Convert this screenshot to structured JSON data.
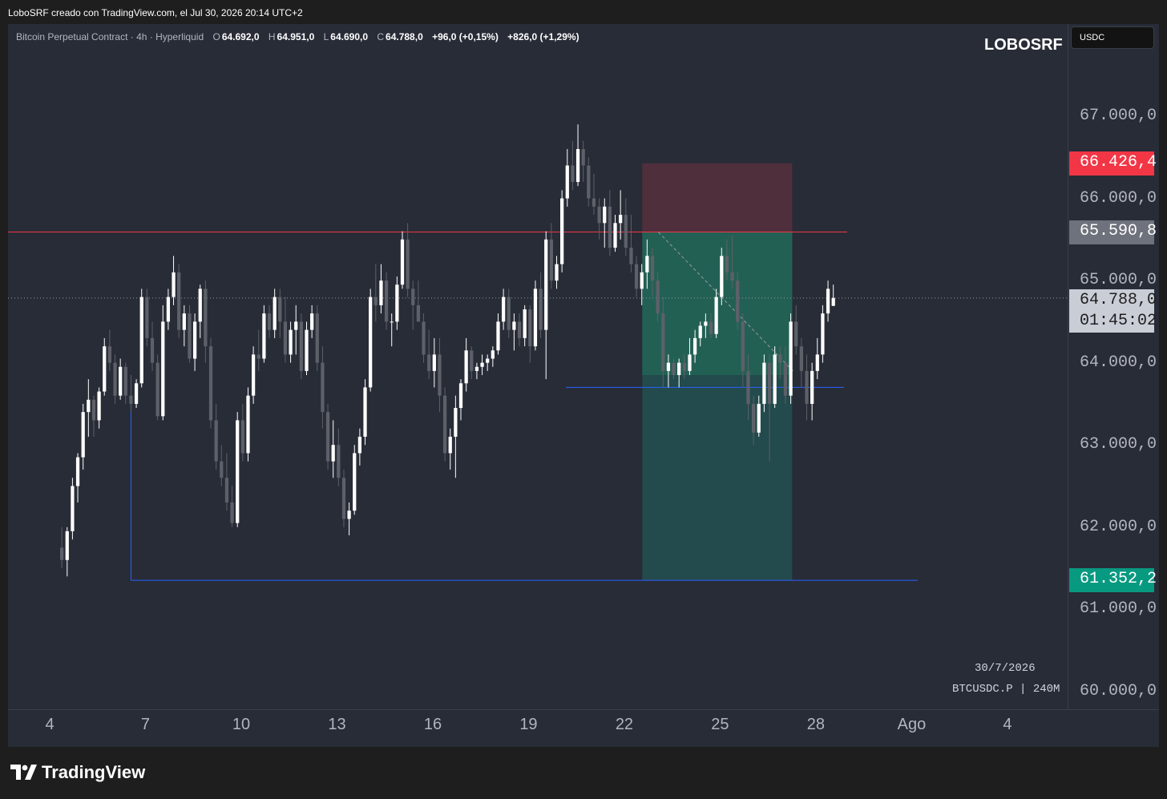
{
  "header": {
    "caption": "LoboSRF creado con TradingView.com, el Jul 30, 2026 20:14 UTC+2"
  },
  "legend": {
    "symbol_title": "Bitcoin Perpetual Contract · 4h · Hyperliquid",
    "o_label": "O",
    "o_value": "64.692,0",
    "h_label": "H",
    "h_value": "64.951,0",
    "l_label": "L",
    "l_value": "64.690,0",
    "c_label": "C",
    "c_value": "64.788,0",
    "change": "+96,0 (+0,15%)",
    "change2": "+826,0 (+1,29%)"
  },
  "author": "LOBOSRF",
  "currency": "USDC",
  "price_labels": {
    "stop": "66.426,4",
    "entry": "65.590,8",
    "target": "61.352,2",
    "current": "64.788,0",
    "countdown": "01:45:02"
  },
  "watermark": {
    "date": "30/7/2026",
    "symbol": "BTCUSDC.P | 240M"
  },
  "footer": {
    "brand": "TradingView"
  },
  "colors": {
    "up": "#ffffff",
    "down": "#5d6068",
    "stop_zone": "#4f2f3c",
    "target_zone": "#234a4c",
    "profit_fill": "#236054",
    "stop_badge": "#f23645",
    "entry_badge": "#6e727c",
    "target_badge": "#089981",
    "resistance": "#f23645",
    "support": "#2962ff"
  },
  "chart_data": {
    "type": "candlestick",
    "timeframe": "4h",
    "y_ticks": [
      67000,
      66000,
      65000,
      64000,
      63000,
      62000,
      61000,
      60000
    ],
    "y_tick_labels": [
      "67.000,0",
      "66.000,0",
      "65.000,0",
      "64.000,0",
      "63.000,0",
      "62.000,0",
      "61.000,0",
      "60.000,0"
    ],
    "ylim": [
      59760,
      68500
    ],
    "x_ticks": [
      "4",
      "7",
      "10",
      "13",
      "16",
      "19",
      "22",
      "25",
      "28",
      "Ago",
      "4"
    ],
    "x_tick_days": [
      4,
      7,
      10,
      13,
      16,
      19,
      22,
      25,
      28,
      31,
      34
    ],
    "first_candle_day": 4.38,
    "candles_per_day": 6,
    "candles": [
      [
        61750,
        62000,
        61500,
        61600
      ],
      [
        61600,
        62000,
        61400,
        61950
      ],
      [
        61950,
        62600,
        61850,
        62500
      ],
      [
        62500,
        62900,
        62300,
        62850
      ],
      [
        62850,
        63500,
        62700,
        63400
      ],
      [
        63400,
        63800,
        63100,
        63550
      ],
      [
        63550,
        63600,
        63100,
        63300
      ],
      [
        63300,
        63700,
        63200,
        63650
      ],
      [
        63650,
        64300,
        63600,
        64200
      ],
      [
        64200,
        64400,
        63900,
        64000
      ],
      [
        64000,
        64100,
        63500,
        63600
      ],
      [
        63600,
        64050,
        63550,
        63950
      ],
      [
        63950,
        64000,
        63500,
        63600
      ],
      [
        63600,
        63850,
        63400,
        63500
      ],
      [
        63500,
        63800,
        63450,
        63750
      ],
      [
        63750,
        64900,
        63700,
        64800
      ],
      [
        64800,
        64900,
        64200,
        64300
      ],
      [
        64300,
        64500,
        63900,
        64000
      ],
      [
        64000,
        64100,
        63300,
        63350
      ],
      [
        63350,
        64700,
        63300,
        64500
      ],
      [
        64500,
        64900,
        64400,
        64800
      ],
      [
        64800,
        65300,
        64700,
        65100
      ],
      [
        65100,
        65200,
        64300,
        64400
      ],
      [
        64400,
        64700,
        64200,
        64600
      ],
      [
        64600,
        64700,
        64000,
        64050
      ],
      [
        64050,
        64600,
        63900,
        64500
      ],
      [
        64500,
        64950,
        64300,
        64900
      ],
      [
        64900,
        65000,
        64000,
        64200
      ],
      [
        64200,
        64300,
        63200,
        63300
      ],
      [
        63300,
        63500,
        62700,
        62800
      ],
      [
        62800,
        63000,
        62500,
        62600
      ],
      [
        62600,
        62900,
        62200,
        62300
      ],
      [
        62300,
        62500,
        62000,
        62050
      ],
      [
        62050,
        63400,
        62000,
        63300
      ],
      [
        63300,
        63500,
        62800,
        62900
      ],
      [
        62900,
        63700,
        62800,
        63600
      ],
      [
        63600,
        64200,
        63500,
        64100
      ],
      [
        64100,
        64400,
        63900,
        64050
      ],
      [
        64050,
        64700,
        64000,
        64600
      ],
      [
        64600,
        64700,
        64300,
        64400
      ],
      [
        64400,
        64900,
        64300,
        64800
      ],
      [
        64800,
        64900,
        64300,
        64500
      ],
      [
        64500,
        64800,
        64000,
        64100
      ],
      [
        64100,
        64500,
        64000,
        64400
      ],
      [
        64400,
        64700,
        64100,
        64500
      ],
      [
        64500,
        64600,
        63800,
        63900
      ],
      [
        63900,
        64500,
        63850,
        64400
      ],
      [
        64400,
        64700,
        64300,
        64600
      ],
      [
        64600,
        64700,
        63900,
        64000
      ],
      [
        64000,
        64200,
        63200,
        63400
      ],
      [
        63400,
        63500,
        62700,
        62800
      ],
      [
        62800,
        63300,
        62600,
        63000
      ],
      [
        63000,
        63200,
        62500,
        62600
      ],
      [
        62600,
        62700,
        62000,
        62100
      ],
      [
        62100,
        62300,
        61900,
        62200
      ],
      [
        62200,
        63000,
        62150,
        62900
      ],
      [
        62900,
        63200,
        62750,
        63100
      ],
      [
        63100,
        63800,
        63000,
        63700
      ],
      [
        63700,
        64900,
        63650,
        64800
      ],
      [
        64800,
        65200,
        64500,
        64700
      ],
      [
        64700,
        65200,
        64600,
        65000
      ],
      [
        65000,
        65100,
        64400,
        64500
      ],
      [
        64500,
        64600,
        64200,
        64500
      ],
      [
        64500,
        65050,
        64400,
        64950
      ],
      [
        64950,
        65600,
        64900,
        65500
      ],
      [
        65500,
        65700,
        64800,
        64900
      ],
      [
        64900,
        65000,
        64400,
        64700
      ],
      [
        64700,
        65000,
        64500,
        64500
      ],
      [
        64500,
        64600,
        64000,
        64100
      ],
      [
        64100,
        64400,
        63800,
        63900
      ],
      [
        63900,
        64300,
        63700,
        64100
      ],
      [
        64100,
        64300,
        63400,
        63600
      ],
      [
        63600,
        63700,
        62800,
        62900
      ],
      [
        62900,
        63200,
        62700,
        63100
      ],
      [
        63100,
        63600,
        62600,
        63450
      ],
      [
        63450,
        63800,
        63300,
        63750
      ],
      [
        63750,
        64300,
        63650,
        64150
      ],
      [
        64150,
        64200,
        63800,
        63900
      ],
      [
        63900,
        64000,
        63800,
        63950
      ],
      [
        63950,
        64100,
        63850,
        64000
      ],
      [
        64000,
        64100,
        63900,
        64050
      ],
      [
        64050,
        64200,
        63950,
        64150
      ],
      [
        64150,
        64600,
        64100,
        64500
      ],
      [
        64500,
        64900,
        64400,
        64800
      ],
      [
        64800,
        64900,
        64300,
        64400
      ],
      [
        64400,
        64600,
        64150,
        64500
      ],
      [
        64500,
        64600,
        64200,
        64300
      ],
      [
        64300,
        64700,
        64200,
        64650
      ],
      [
        64650,
        64700,
        64000,
        64200
      ],
      [
        64200,
        65000,
        64150,
        64900
      ],
      [
        64900,
        65100,
        64300,
        64400
      ],
      [
        64400,
        65600,
        63800,
        65500
      ],
      [
        65500,
        65700,
        64900,
        65000
      ],
      [
        65000,
        65300,
        64900,
        65200
      ],
      [
        65200,
        66100,
        65100,
        66000
      ],
      [
        66000,
        66600,
        65900,
        66400
      ],
      [
        66400,
        66700,
        66100,
        66200
      ],
      [
        66200,
        66900,
        66150,
        66600
      ],
      [
        66600,
        66700,
        66200,
        66400
      ],
      [
        66400,
        66500,
        65900,
        66000
      ],
      [
        66000,
        66300,
        65800,
        65900
      ],
      [
        65900,
        66000,
        65500,
        65700
      ],
      [
        65700,
        66000,
        65400,
        65900
      ],
      [
        65900,
        66100,
        65300,
        65400
      ],
      [
        65400,
        65800,
        65350,
        65700
      ],
      [
        65700,
        66100,
        65500,
        65800
      ],
      [
        65800,
        66000,
        65300,
        65400
      ],
      [
        65400,
        65800,
        65100,
        65200
      ],
      [
        65200,
        65300,
        64800,
        64900
      ],
      [
        64900,
        65200,
        64700,
        65100
      ],
      [
        65100,
        65500,
        64900,
        65300
      ],
      [
        65300,
        65400,
        64800,
        65000
      ],
      [
        65000,
        65100,
        64500,
        64600
      ],
      [
        64600,
        64800,
        63700,
        63900
      ],
      [
        63900,
        64100,
        63700,
        64000
      ],
      [
        64000,
        64050,
        63800,
        63850
      ],
      [
        63850,
        64050,
        63700,
        64000
      ],
      [
        64000,
        64100,
        63800,
        63900
      ],
      [
        63900,
        64300,
        63850,
        64100
      ],
      [
        64100,
        64400,
        64000,
        64300
      ],
      [
        64300,
        64500,
        64200,
        64450
      ],
      [
        64450,
        64600,
        64300,
        64500
      ],
      [
        64500,
        64600,
        64300,
        64350
      ],
      [
        64350,
        64900,
        64300,
        64800
      ],
      [
        64800,
        65400,
        64700,
        65300
      ],
      [
        65300,
        65500,
        65000,
        65100
      ],
      [
        65100,
        65550,
        64900,
        65000
      ],
      [
        65000,
        65100,
        64400,
        64500
      ],
      [
        64500,
        64600,
        63700,
        63900
      ],
      [
        63900,
        64100,
        63300,
        63500
      ],
      [
        63500,
        63600,
        63000,
        63150
      ],
      [
        63150,
        63600,
        63100,
        63500
      ],
      [
        63500,
        64100,
        63400,
        64000
      ],
      [
        64000,
        64100,
        62800,
        63500
      ],
      [
        63500,
        64200,
        63450,
        64100
      ],
      [
        64100,
        64200,
        63800,
        64000
      ],
      [
        64000,
        64200,
        63500,
        63600
      ],
      [
        63600,
        64600,
        63500,
        64500
      ],
      [
        64500,
        64700,
        64100,
        64200
      ],
      [
        64200,
        64300,
        63700,
        63900
      ],
      [
        63900,
        64100,
        63300,
        63500
      ],
      [
        63500,
        64000,
        63300,
        63900
      ],
      [
        63900,
        64300,
        63800,
        64100
      ],
      [
        64100,
        64700,
        64000,
        64600
      ],
      [
        64600,
        65000,
        64500,
        64900
      ],
      [
        64692,
        64951,
        64690,
        64788
      ]
    ],
    "levels": {
      "resistance": 65590.8,
      "support_mid": 63700,
      "support_low": 61352.2
    },
    "position": {
      "stop": 66426.4,
      "entry": 65590.8,
      "target": 61352.2,
      "profit_fill_to": 63850
    },
    "current_price": 64788.0
  }
}
